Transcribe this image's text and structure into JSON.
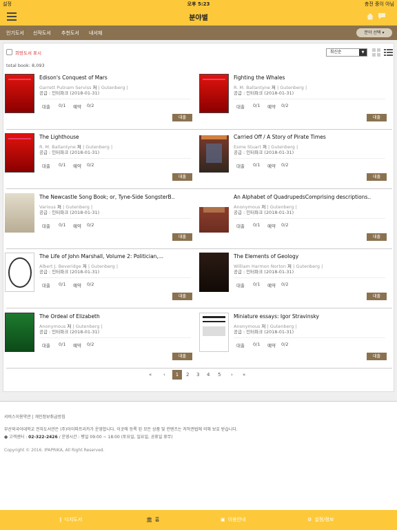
{
  "status": {
    "left": "설정",
    "time": "오후 5:23",
    "right": "충전 중이 아님"
  },
  "header": {
    "title": "분야별"
  },
  "subnav": {
    "tabs": [
      "인기도서",
      "신작도서",
      "추천도서",
      "내서재"
    ],
    "select": "분야 선택"
  },
  "toolbar": {
    "checkbox_label": "희망도서 표시",
    "sort": "최신순"
  },
  "total": "total book: 8,093",
  "labels": {
    "author_suffix": "저",
    "lend": "대출",
    "reserve": "예약",
    "lend_button": "대출",
    "publisher_prefix": "공급 :"
  },
  "books": [
    {
      "title": "Edison's Conquest of Mars",
      "author": "Garrett Putnam Serviss",
      "source": "Gutenberg",
      "publisher": "인터파크",
      "date": "(2018-01-31)",
      "lend": "0/1",
      "reserve": "0/2"
    },
    {
      "title": "Fighting the Whales",
      "author": "R. M. Ballantyne",
      "source": "Gutenberg",
      "publisher": "인터파크",
      "date": "(2018-01-31)",
      "lend": "0/1",
      "reserve": "0/2"
    },
    {
      "title": "The Lighthouse",
      "author": "R. M. Ballantyne",
      "source": "Gutenberg",
      "publisher": "인터파크",
      "date": "(2018-01-31)",
      "lend": "0/1",
      "reserve": "0/2"
    },
    {
      "title": "Carried Off / A Story of Pirate Times",
      "author": "Esme Stuart",
      "source": "Gutenberg",
      "publisher": "인터파크",
      "date": "(2018-01-31)",
      "lend": "0/1",
      "reserve": "0/2"
    },
    {
      "title": "The Newcastle Song Book; or, Tyne-Side SongsterB..",
      "author": "Various",
      "source": "Gutenberg",
      "publisher": "인터파크",
      "date": "(2018-01-31)",
      "lend": "0/1",
      "reserve": "0/2"
    },
    {
      "title": "An Alphabet of QuadrupedsComprising descriptions..",
      "author": "Anonymous",
      "source": "Gutenberg",
      "publisher": "인터파크",
      "date": "(2018-01-31)",
      "lend": "0/1",
      "reserve": "0/2"
    },
    {
      "title": "The Life of John Marshall, Volume 2: Politician,...",
      "author": "Albert J. Beveridge",
      "source": "Gutenberg",
      "publisher": "인터파크",
      "date": "(2018-01-31)",
      "lend": "0/1",
      "reserve": "0/2"
    },
    {
      "title": "The Elements of Geology",
      "author": "William Harmon Norton",
      "source": "Gutenberg",
      "publisher": "인터파크",
      "date": "(2018-01-31)",
      "lend": "0/1",
      "reserve": "0/2"
    },
    {
      "title": "The Ordeal of Elizabeth",
      "author": "Anonymous",
      "source": "Gutenberg",
      "publisher": "인터파크",
      "date": "(2018-01-31)",
      "lend": "0/1",
      "reserve": "0/2"
    },
    {
      "title": "Miniature essays: Igor Stravinsky",
      "author": "Anonymous",
      "source": "Gutenberg",
      "publisher": "인터파크",
      "date": "(2018-01-31)",
      "lend": "0/1",
      "reserve": "0/2"
    }
  ],
  "pager": {
    "first": "«",
    "prev": "‹",
    "pages": [
      "1",
      "2",
      "3",
      "4",
      "5"
    ],
    "next": "›",
    "last": "»",
    "current": "1"
  },
  "footer": {
    "links": "서비스이용약관  |  개인정보취급방침",
    "notice": "부산외국어대학교 전자도서관은 (주)아이파프리카가 운영합니다. 이곳에 등록 된 모든 상품 및 컨텐츠는 저작권법에 의해 보호 받습니다.",
    "center_label": "고객센터 :",
    "center_phone": "02-322-2426",
    "center_hours": "/ 운영시간 : 평일 09:00 ~ 18:00 (토요일, 일요일, 공휴일 휴무)",
    "copyright": "Copyright © 2016. IPAPRIKA, All Right Reserved."
  },
  "bottom": {
    "items": [
      "디지도서",
      "홈",
      "이용안내",
      "설정/정보"
    ]
  },
  "colors": {
    "accent": "#fdc93a",
    "brown": "#8a7250"
  }
}
